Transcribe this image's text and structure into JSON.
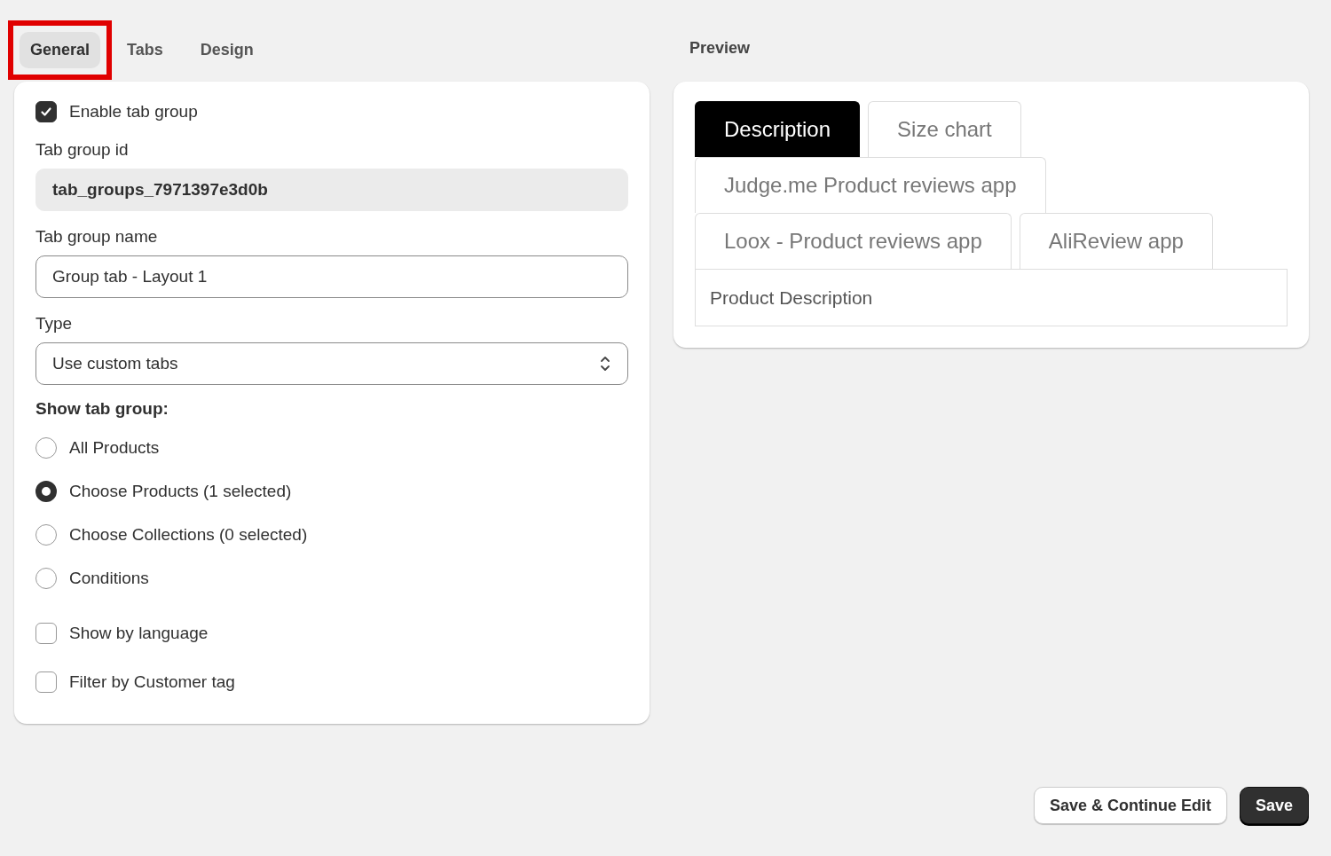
{
  "tabs": [
    {
      "label": "General",
      "selected": true,
      "highlighted": true
    },
    {
      "label": "Tabs",
      "selected": false,
      "highlighted": false
    },
    {
      "label": "Design",
      "selected": false,
      "highlighted": false
    }
  ],
  "form": {
    "enable": {
      "label": "Enable tab group",
      "checked": true
    },
    "id_field": {
      "label": "Tab group id",
      "value": "tab_groups_7971397e3d0b",
      "disabled": true
    },
    "name_field": {
      "label": "Tab group name",
      "value": "Group tab - Layout 1"
    },
    "type_field": {
      "label": "Type",
      "value": "Use custom tabs"
    },
    "show_heading": "Show tab group:",
    "radios": [
      {
        "label": "All Products",
        "selected": false
      },
      {
        "label": "Choose Products (1 selected)",
        "selected": true
      },
      {
        "label": "Choose Collections (0 selected)",
        "selected": false
      },
      {
        "label": "Conditions",
        "selected": false
      }
    ],
    "checkboxes": [
      {
        "label": "Show by language",
        "checked": false
      },
      {
        "label": "Filter by Customer tag",
        "checked": false
      }
    ]
  },
  "preview": {
    "title": "Preview",
    "tabs": [
      {
        "label": "Description",
        "selected": true
      },
      {
        "label": "Size chart",
        "selected": false
      },
      {
        "label": "Judge.me Product reviews app",
        "selected": false
      },
      {
        "label": "Loox - Product reviews app",
        "selected": false
      },
      {
        "label": "AliReview app",
        "selected": false
      }
    ],
    "content": "Product Description"
  },
  "buttons": [
    {
      "label": "Save & Continue Edit",
      "kind": "secondary"
    },
    {
      "label": "Save",
      "kind": "primary"
    }
  ]
}
